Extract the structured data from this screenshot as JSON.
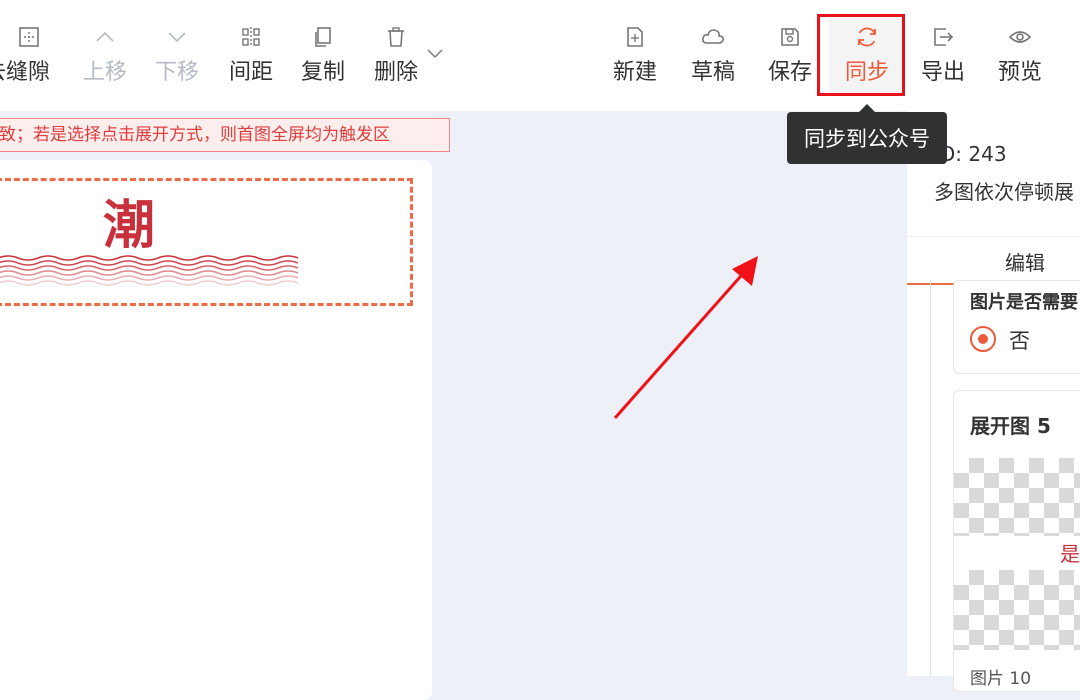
{
  "toolbar": {
    "items": [
      {
        "label": "去缝隙",
        "icon": "grid-icon",
        "disabled": false
      },
      {
        "label": "上移",
        "icon": "chevron-up-icon",
        "disabled": true
      },
      {
        "label": "下移",
        "icon": "chevron-down-icon",
        "disabled": true
      },
      {
        "label": "间距",
        "icon": "spacing-icon",
        "disabled": false
      },
      {
        "label": "复制",
        "icon": "copy-icon",
        "disabled": false
      },
      {
        "label": "删除",
        "icon": "trash-icon",
        "disabled": false
      },
      {
        "label": "新建",
        "icon": "new-file-icon",
        "disabled": false
      },
      {
        "label": "草稿",
        "icon": "cloud-icon",
        "disabled": false
      },
      {
        "label": "保存",
        "icon": "save-icon",
        "disabled": false
      },
      {
        "label": "同步",
        "icon": "sync-icon",
        "disabled": false,
        "active": true
      },
      {
        "label": "导出",
        "icon": "export-icon",
        "disabled": false
      },
      {
        "label": "预览",
        "icon": "eye-icon",
        "disabled": false
      }
    ],
    "tooltip": "同步到公众号"
  },
  "notice": "致；若是选择点击展开方式，则首图全屏均为触发区",
  "canvas": {
    "glyph": "潮"
  },
  "panel": {
    "id_text": "ID: 243",
    "desc": "多图依次停顿展",
    "tab": "编辑",
    "question": "图片是否需要",
    "radio_label": "否",
    "expand_title": "展开图 5",
    "image_glyph": "是",
    "pic_label": "图片 10"
  },
  "colors": {
    "accent": "#ee5a3a",
    "highlight": "#e8121a",
    "arrow": "#f01218"
  }
}
